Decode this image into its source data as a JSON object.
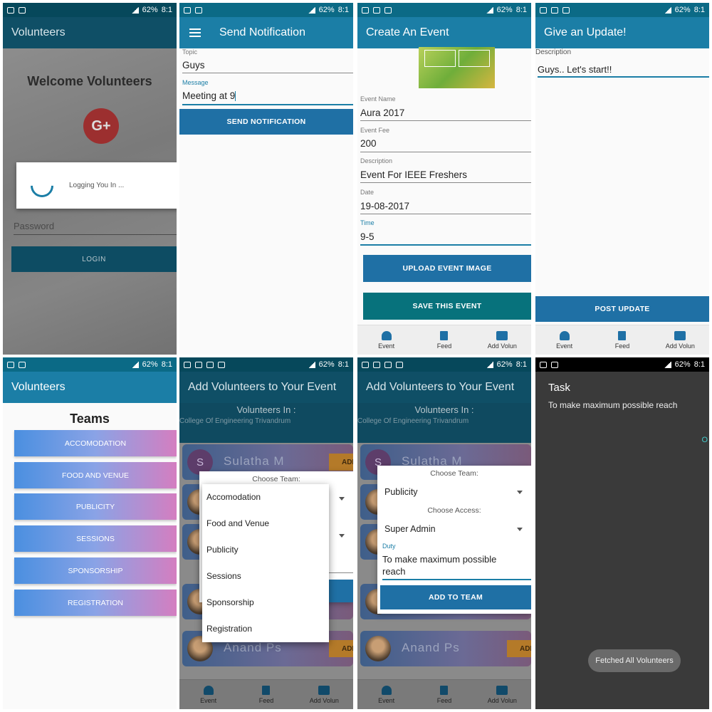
{
  "status": {
    "battery": "62%",
    "time": "8:1"
  },
  "panel1": {
    "title": "Volunteers",
    "welcome": "Welcome Volunteers",
    "gplus": "G+",
    "dialog_text": "Logging You In ...",
    "password_placeholder": "Password",
    "login": "LOGIN"
  },
  "panel2": {
    "title": "Send Notification",
    "topic_label": "Topic",
    "topic_value": "Guys",
    "message_label": "Message",
    "message_value": "Meeting at 9",
    "send": "SEND NOTIFICATION"
  },
  "panel3": {
    "title": "Create An Event",
    "fields": [
      {
        "label": "Event Name",
        "value": "Aura 2017"
      },
      {
        "label": "Event Fee",
        "value": "200"
      },
      {
        "label": "Description",
        "value": "Event For IEEE Freshers"
      },
      {
        "label": "Date",
        "value": "19-08-2017"
      },
      {
        "label": "Time",
        "value": "9-5"
      }
    ],
    "upload": "UPLOAD EVENT IMAGE",
    "save": "SAVE THIS EVENT"
  },
  "panel4": {
    "title": "Give an Update!",
    "desc_label": "Description",
    "desc_value": "Guys.. Let's start!!",
    "post": "POST UPDATE"
  },
  "nav": {
    "event": "Event",
    "feed": "Feed",
    "add": "Add Volun"
  },
  "panel5": {
    "title": "Volunteers",
    "teams_heading": "Teams",
    "teams": [
      "ACCOMODATION",
      "FOOD AND VENUE",
      "PUBLICITY",
      "SESSIONS",
      "SPONSORSHIP",
      "REGISTRATION"
    ]
  },
  "panel6": {
    "title": "Add Volunteers to Your Event",
    "vol_in": "Volunteers In :",
    "college": "College Of Engineering Trivandrum",
    "card1_initial": "S",
    "card1_name": "Sulatha M",
    "card2_name": "Anand Ps",
    "add_short": "ADD",
    "choose_team": "Choose Team:",
    "options": [
      "Accomodation",
      "Food and Venue",
      "Publicity",
      "Sessions",
      "Sponsorship",
      "Registration"
    ]
  },
  "panel7": {
    "choose_team": "Choose Team:",
    "team_value": "Publicity",
    "choose_access": "Choose Access:",
    "access_value": "Super Admin",
    "duty_label": "Duty",
    "duty_line1": "To make maximum possible",
    "duty_line2": "reach",
    "add_to_team": "ADD TO TEAM"
  },
  "panel8": {
    "task_title": "Task",
    "task_desc": "To make maximum possible reach",
    "stray": "O",
    "toast": "Fetched All Volunteers"
  }
}
